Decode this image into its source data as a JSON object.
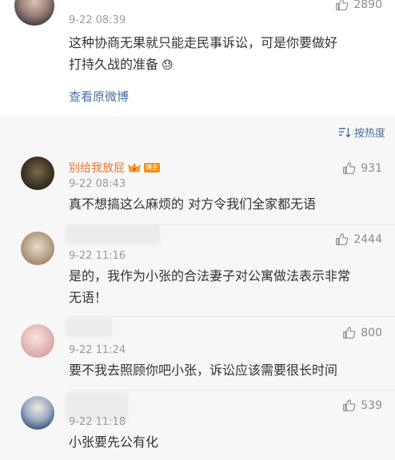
{
  "top_comment": {
    "time": "9-22 08:39",
    "likes": "2890",
    "text_line1": "这种协商无果就只能走民事诉讼，可是你要做好",
    "text_line2": "打持久战的准备",
    "emoji": "😓",
    "view_original": "查看原微博"
  },
  "sort_label": "按热度",
  "replies": [
    {
      "username": "别给我放屁",
      "badge": "博主",
      "time": "9-22 08:43",
      "likes": "931",
      "text": "真不想搞这么麻烦的 对方令我们全家都无语"
    },
    {
      "time": "9-22 11:16",
      "likes": "2444",
      "text_line1": "是的，我作为小张的合法妻子对公寓做法表示非常",
      "text_line2": "无语！"
    },
    {
      "time": "9-22 11:24",
      "likes": "800",
      "text": "要不我去照顾你吧小张，诉讼应该需要很长时间"
    },
    {
      "time": "9-22 11:18",
      "likes": "539",
      "text": "小张要先公有化"
    }
  ],
  "colors": {
    "link": "#4a6f9c",
    "username": "#e5772d",
    "badge": "#f29016"
  }
}
